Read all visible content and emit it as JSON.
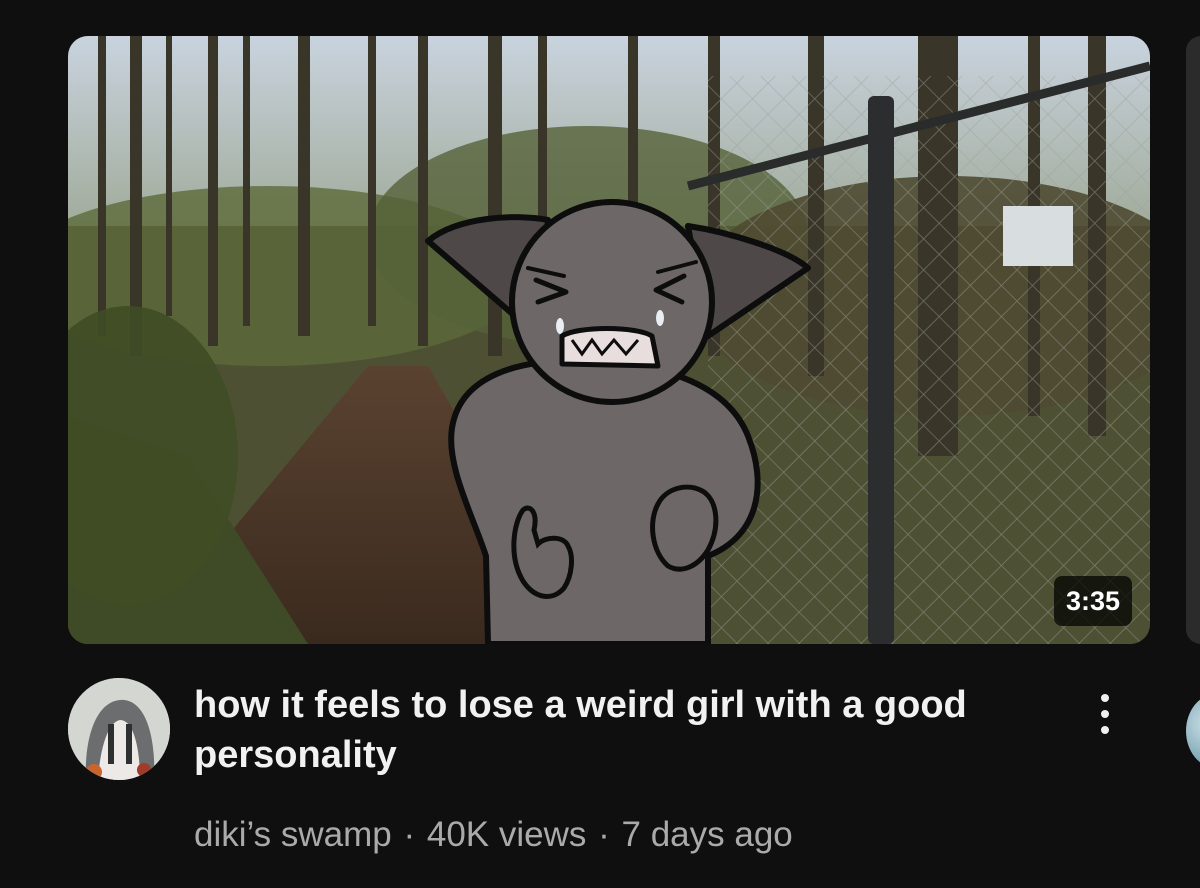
{
  "video": {
    "title": "how it feels to lose a weird girl with a good personality",
    "duration": "3:35",
    "channel": "diki’s swamp",
    "views": "40K views",
    "uploaded": "7 days ago",
    "separator": "·"
  },
  "icons": {
    "more": "more-vertical-icon"
  },
  "colors": {
    "background": "#0f0f0f",
    "title_text": "#f1f1f1",
    "meta_text": "#aaaaaa",
    "badge_bg": "#000000",
    "character_fill": "#6e6768"
  }
}
